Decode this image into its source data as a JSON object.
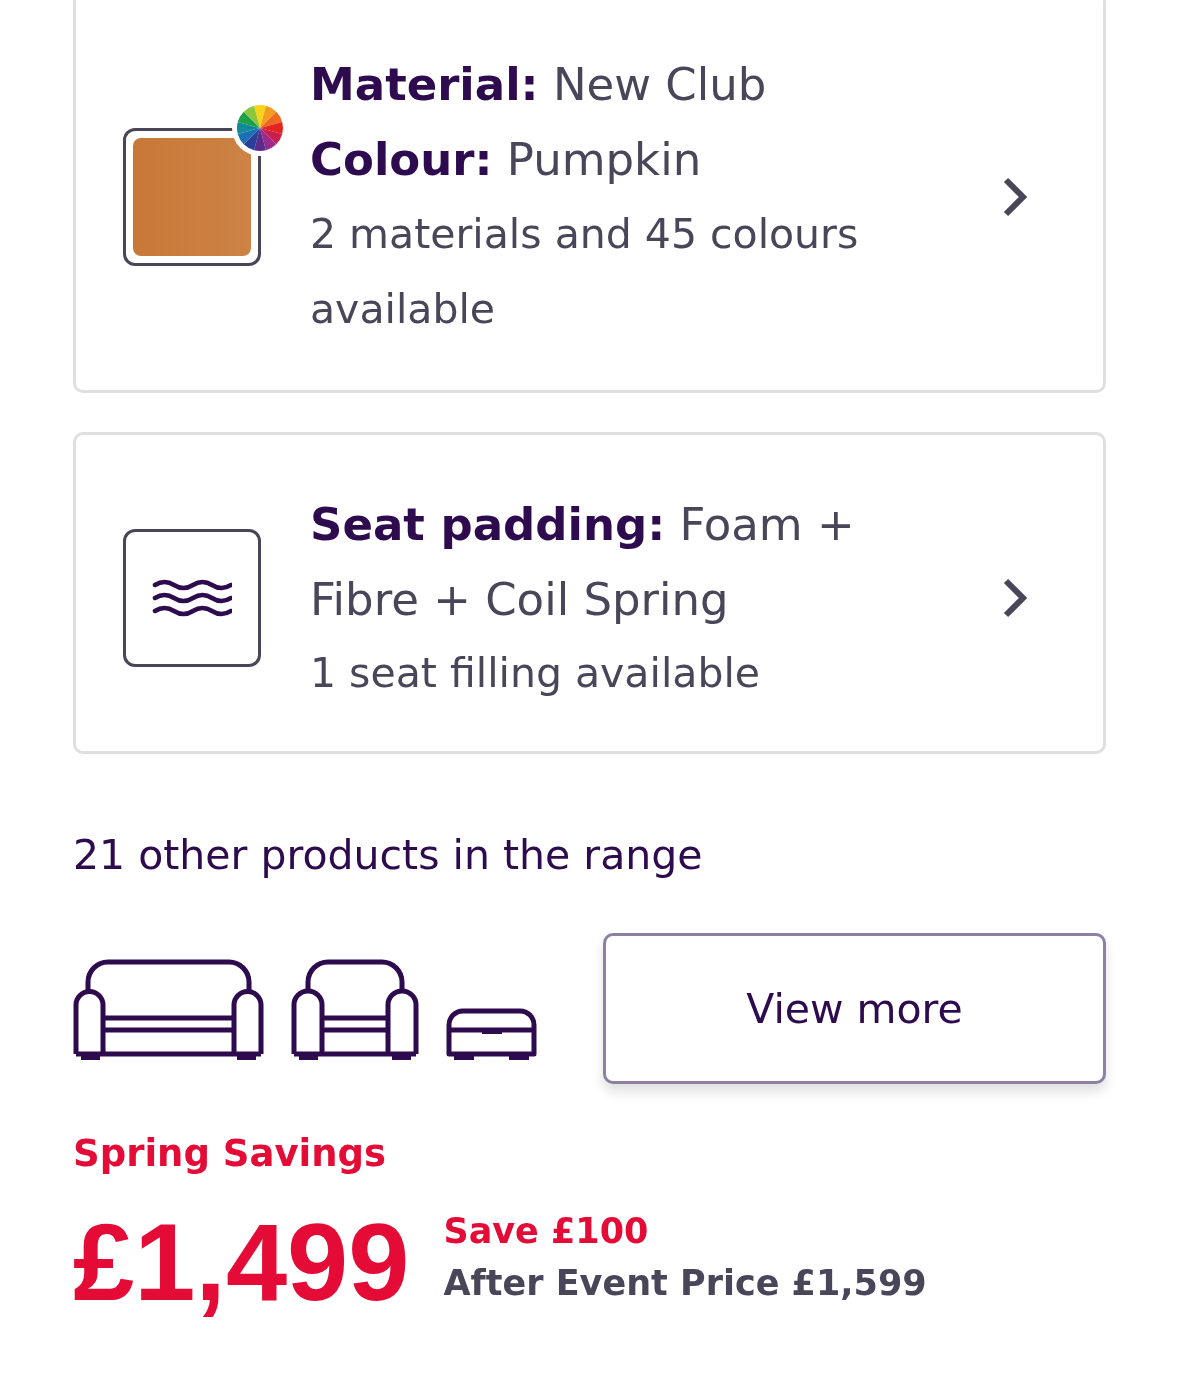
{
  "options": [
    {
      "kind": "material",
      "lines": [
        "**Material:** New Club",
        "**Colour:** Pumpkin"
      ],
      "note": "2 materials and 45 colours available"
    },
    {
      "kind": "padding",
      "lines": [
        "**Seat padding:** Foam + Fibre + Coil Spring"
      ],
      "note": "1 seat filling available"
    }
  ],
  "range": {
    "title": "21 other products in the range",
    "button": "View more"
  },
  "pricing": {
    "event": "Spring Savings",
    "price": "£1,499",
    "saving": "Save £100",
    "after_event_price": "After Event Price £1,599"
  }
}
